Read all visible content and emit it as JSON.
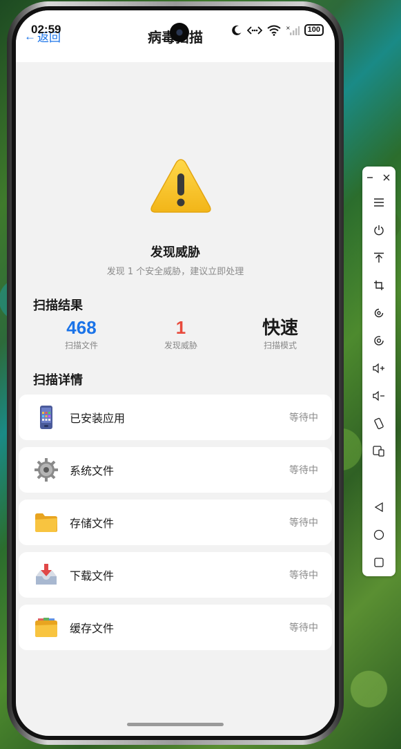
{
  "status_bar": {
    "time": "02:59",
    "battery": "100"
  },
  "header": {
    "back_label": "返回",
    "back_arrow": "←",
    "title": "病毒扫描"
  },
  "alert": {
    "icon": "warning-icon",
    "title": "发现威胁",
    "subtitle": "发现 1 个安全威胁，建议立即处理"
  },
  "results": {
    "title": "扫描结果",
    "stats": [
      {
        "value": "468",
        "label": "扫描文件",
        "color": "#1a73e8"
      },
      {
        "value": "1",
        "label": "发现威胁",
        "color": "#e84a3c"
      },
      {
        "value": "快速",
        "label": "扫描模式",
        "color": "#1a1a1a"
      }
    ]
  },
  "details": {
    "title": "扫描详情",
    "items": [
      {
        "icon": "mobile-phone-icon",
        "label": "已安装应用",
        "status": "等待中"
      },
      {
        "icon": "gear-icon",
        "label": "系统文件",
        "status": "等待中"
      },
      {
        "icon": "folder-icon",
        "label": "存储文件",
        "status": "等待中"
      },
      {
        "icon": "inbox-tray-icon",
        "label": "下载文件",
        "status": "等待中"
      },
      {
        "icon": "card-file-box-icon",
        "label": "缓存文件",
        "status": "等待中"
      }
    ]
  },
  "toolbar": {
    "items": [
      "minimize-icon",
      "close-icon",
      "menu-icon",
      "power-icon",
      "upload-icon",
      "crop-icon",
      "rotate-icon",
      "record-icon",
      "volume-up-icon",
      "volume-down-icon",
      "rotate-screen-icon",
      "device-switch-icon",
      "back-triangle-icon",
      "home-circle-icon",
      "recents-square-icon"
    ]
  },
  "colors": {
    "accent": "#1a73e8",
    "danger": "#e84a3c",
    "background": "#f2f2f2"
  }
}
